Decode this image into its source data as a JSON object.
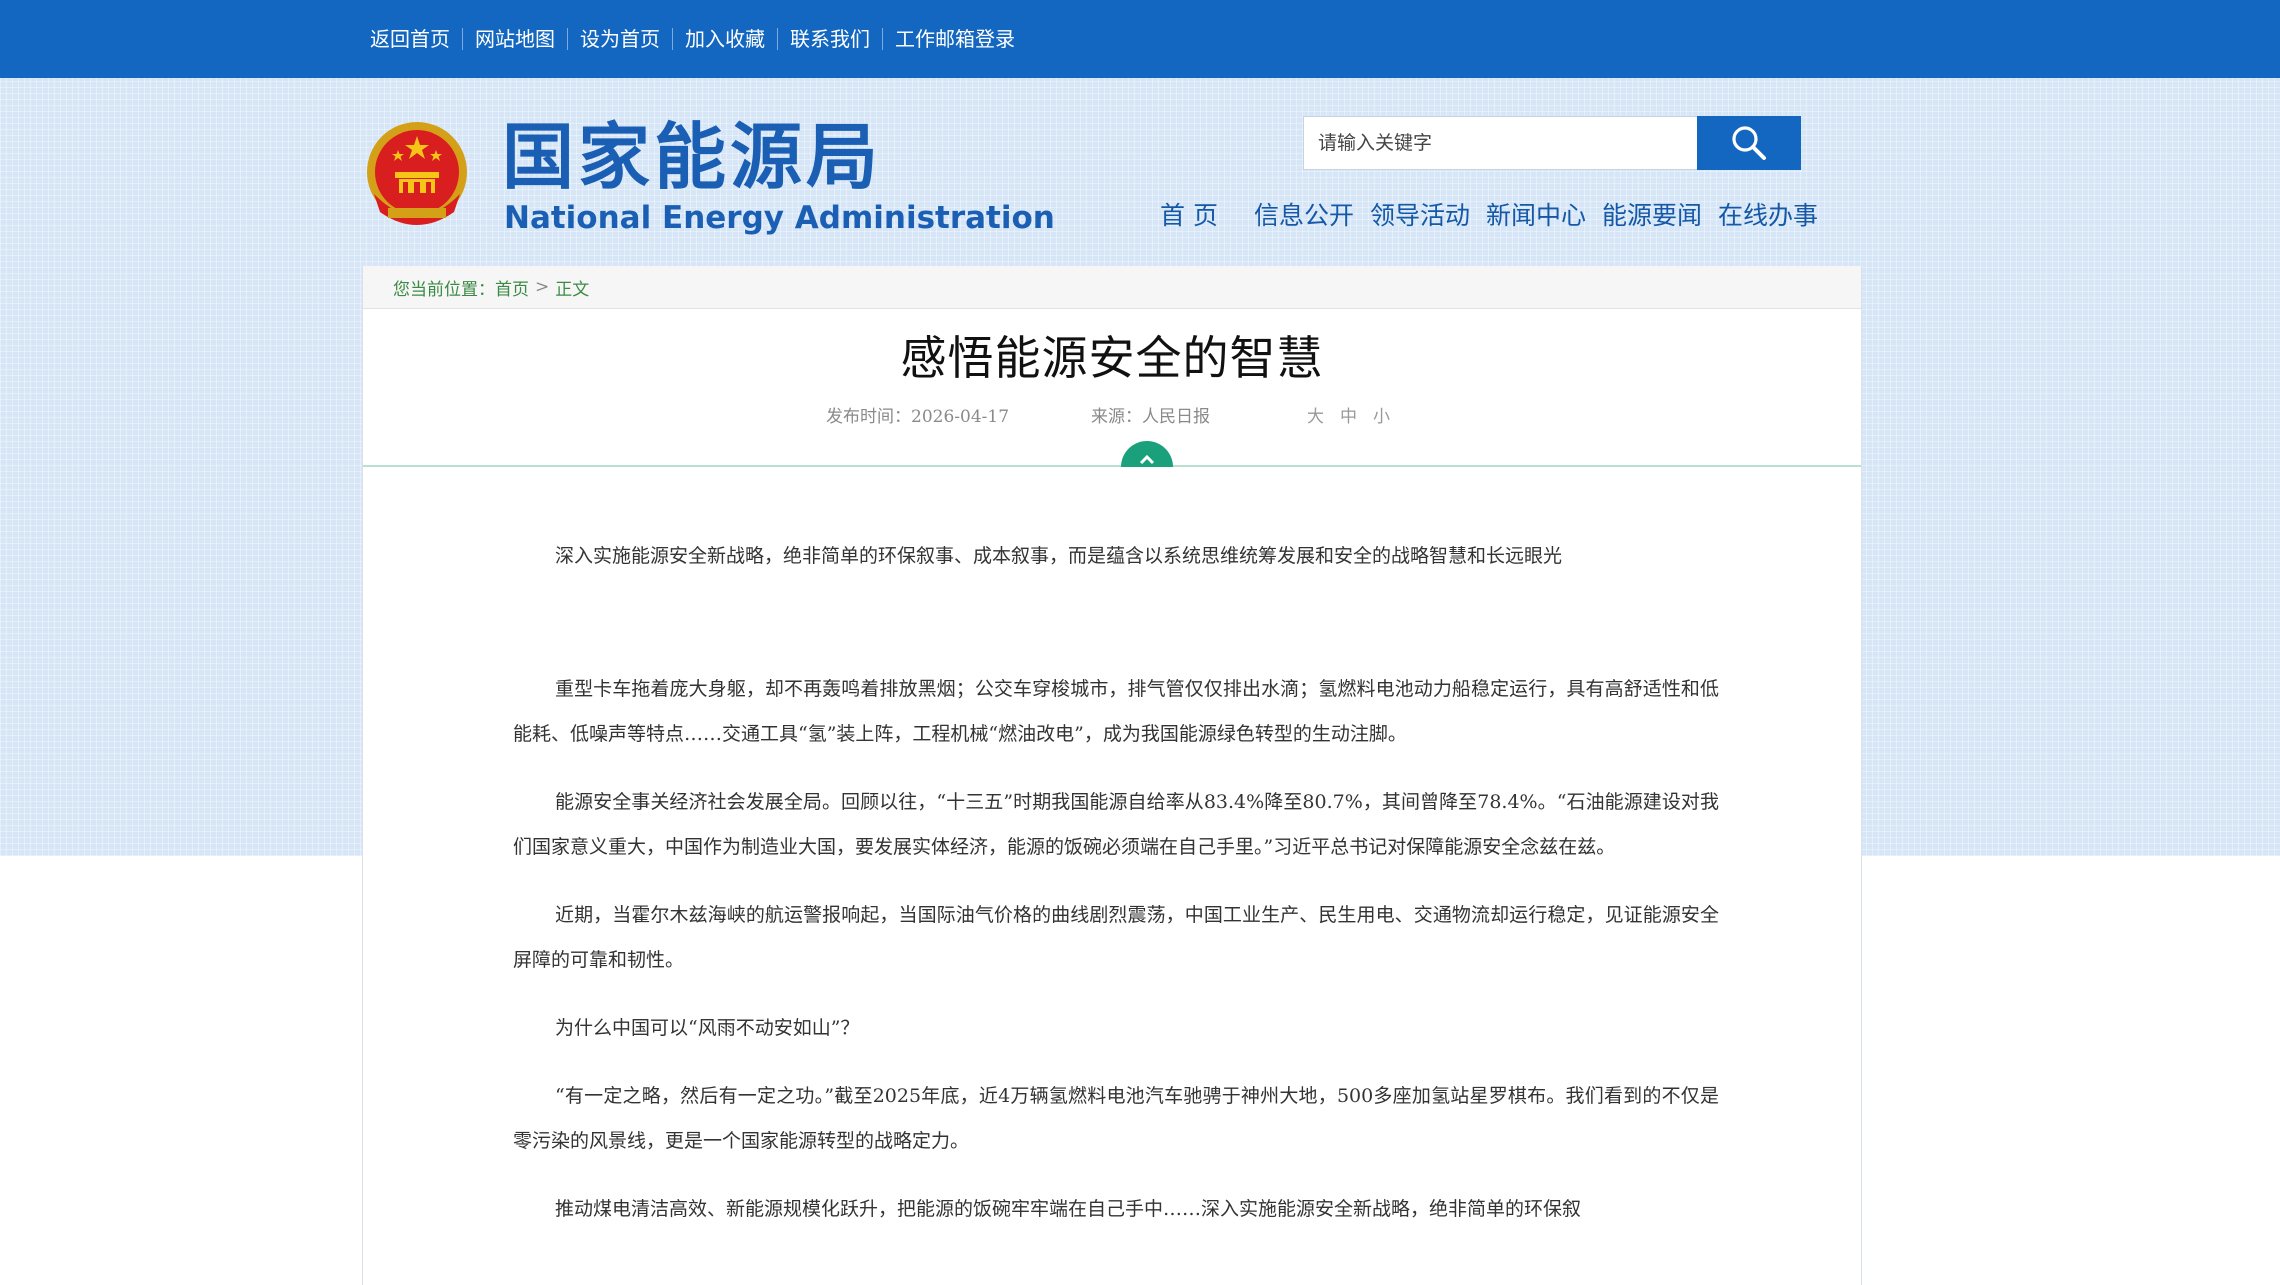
{
  "topbar": {
    "links": [
      "返回首页",
      "网站地图",
      "设为首页",
      "加入收藏",
      "联系我们",
      "工作邮箱登录"
    ]
  },
  "header": {
    "logo_cn": "国家能源局",
    "logo_en": "National Energy Administration",
    "search_placeholder": "请输入关键字",
    "nav": [
      "首 页",
      "信息公开",
      "领导活动",
      "新闻中心",
      "能源要闻",
      "在线办事"
    ]
  },
  "breadcrumb": {
    "label": "您当前位置：",
    "home": "首页",
    "sep": ">",
    "current": "正文"
  },
  "article": {
    "title": "感悟能源安全的智慧",
    "publish_label": "发布时间：",
    "publish_date": "2026-04-17",
    "source_label": "来源：",
    "source": "人民日报",
    "font_sizes": [
      "大",
      "中",
      "小"
    ],
    "paragraphs": [
      "深入实施能源安全新战略，绝非简单的环保叙事、成本叙事，而是蕴含以系统思维统筹发展和安全的战略智慧和长远眼光",
      "重型卡车拖着庞大身躯，却不再轰鸣着排放黑烟；公交车穿梭城市，排气管仅仅排出水滴；氢燃料电池动力船稳定运行，具有高舒适性和低能耗、低噪声等特点……交通工具“氢”装上阵，工程机械“燃油改电”，成为我国能源绿色转型的生动注脚。",
      "能源安全事关经济社会发展全局。回顾以往，“十三五”时期我国能源自给率从83.4%降至80.7%，其间曾降至78.4%。“石油能源建设对我们国家意义重大，中国作为制造业大国，要发展实体经济，能源的饭碗必须端在自己手里。”习近平总书记对保障能源安全念兹在兹。",
      "近期，当霍尔木兹海峡的航运警报响起，当国际油气价格的曲线剧烈震荡，中国工业生产、民生用电、交通物流却运行稳定，见证能源安全屏障的可靠和韧性。",
      "为什么中国可以“风雨不动安如山”？",
      "“有一定之略，然后有一定之功。”截至2025年底，近4万辆氢燃料电池汽车驰骋于神州大地，500多座加氢站星罗棋布。我们看到的不仅是零污染的风景线，更是一个国家能源转型的战略定力。",
      "推动煤电清洁高效、新能源规模化跃升，把能源的饭碗牢牢端在自己手中……深入实施能源安全新战略，绝非简单的环保叙"
    ]
  },
  "colors": {
    "topbar_bg": "#1467c0",
    "brand_blue": "#1a5fb4",
    "crumb_green": "#3b8a43",
    "accent_teal": "#1aa07a",
    "page_bg": "#d6e6f7"
  },
  "icons": {
    "emblem": "national-emblem-icon",
    "search": "search-icon",
    "collapse": "chevron-up-icon"
  }
}
